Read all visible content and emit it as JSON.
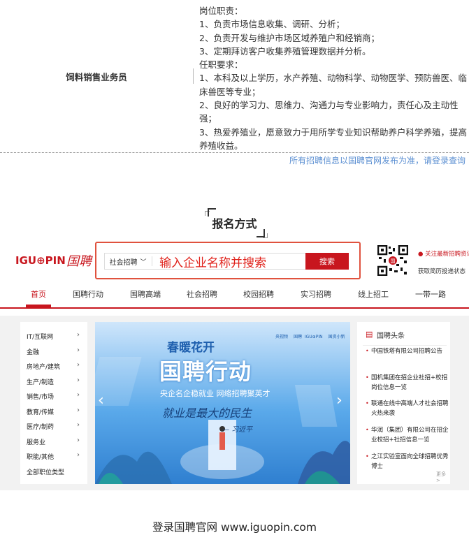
{
  "job": {
    "title": "饲料销售业务员",
    "desc_lines": [
      "岗位职责：",
      "1、负责市场信息收集、调研、分析；",
      "2、负责开发与维护市场区域养殖户和经销商；",
      "3、定期拜访客户收集养殖管理数据并分析。",
      "任职要求：",
      "1、本科及以上学历，水产养殖、动物科学、动物医学、预防兽医、临床兽医等专业；",
      "2、良好的学习力、思维力、沟通力与专业影响力，责任心及主动性强；",
      "3、热爱养殖业，愿意致力于用所学专业知识帮助养户科学养殖，提高养殖收益。"
    ]
  },
  "notice": "所有招聘信息以国聘官网发布为准，请登录查询",
  "section_title": "报名方式",
  "site": {
    "logo_text": "IGU⊕PIN",
    "logo_cn": "国聘",
    "search": {
      "select_label": "社会招聘",
      "select_icon": "chevron-down-icon",
      "placeholder": "输入企业名称并搜索",
      "button": "搜索"
    },
    "qr_text1": "关注最新招聘资讯",
    "qr_text2": "获取简历投递状态",
    "nav": [
      "首页",
      "国聘行动",
      "国聘高端",
      "社会招聘",
      "校园招聘",
      "实习招聘",
      "线上招工",
      "一带一路"
    ],
    "categories": [
      "IT/互联网",
      "金融",
      "房地产/建筑",
      "生产/制造",
      "销售/市场",
      "教育/传媒",
      "医疗/制药",
      "服务业",
      "职能/其他",
      "全部职位类型"
    ],
    "banner": {
      "headline": "春暖花开",
      "logos": [
        "央视频",
        "国聘",
        "IGU⊕PIN",
        "国资小新"
      ],
      "main": "国聘行动",
      "sub": "央企名企稳就业  网络招聘聚英才",
      "quote": "就业是最大的民生",
      "author": "— 习近平"
    },
    "news": {
      "heading": "国聘头条",
      "items": [
        "中国铁塔有限公司招聘公告",
        "国机集团在招企业社招+校招岗位信息一览",
        "联通在线中高端人才社会招聘火热来袭",
        "华润（集团）有限公司在招企业校招+社招信息一览",
        "之江实验室面向全球招聘优秀博士"
      ],
      "more": "更多 >"
    }
  },
  "footer": "登录国聘官网 www.iguopin.com",
  "colors": {
    "brand_red": "#c8161e",
    "link_blue": "#5b8fd2",
    "banner_blue": "#4a9fe0"
  }
}
